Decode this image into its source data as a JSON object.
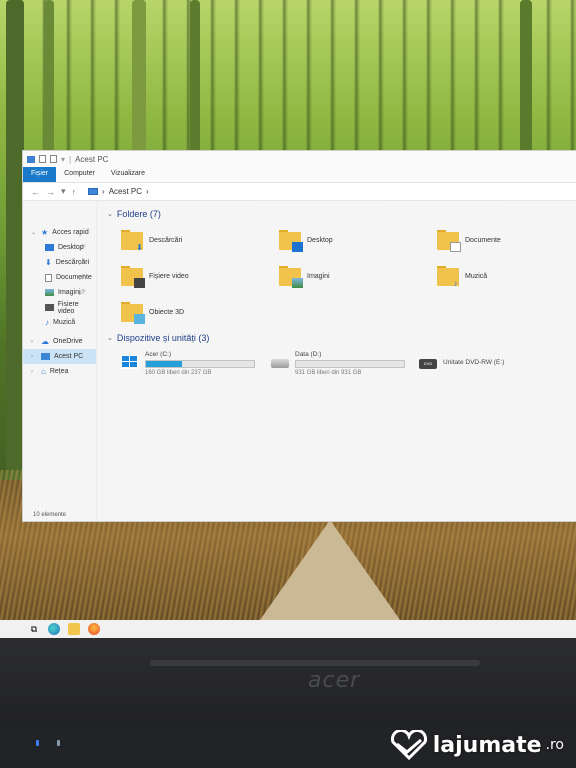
{
  "window": {
    "title": "Acest PC",
    "ribbon_tabs": [
      "Fișier",
      "Computer",
      "Vizualizare"
    ],
    "address": "Acest PC"
  },
  "sidebar": {
    "items": [
      {
        "label": "Acces rapid",
        "icon": "star-icon"
      },
      {
        "label": "Desktop",
        "icon": "desktop-icon"
      },
      {
        "label": "Descărcări",
        "icon": "download-icon"
      },
      {
        "label": "Documente",
        "icon": "document-icon"
      },
      {
        "label": "Imagini",
        "icon": "image-icon"
      },
      {
        "label": "Fisiere video",
        "icon": "video-icon"
      },
      {
        "label": "Muzică",
        "icon": "music-icon"
      },
      {
        "label": "OneDrive",
        "icon": "cloud-icon"
      },
      {
        "label": "Acest PC",
        "icon": "pc-icon"
      },
      {
        "label": "Rețea",
        "icon": "network-icon"
      }
    ],
    "status": "10 elemente"
  },
  "main": {
    "folders_title": "Foldere (7)",
    "folders": [
      {
        "label": "Descărcări",
        "icon": "download-folder-icon"
      },
      {
        "label": "Desktop",
        "icon": "desktop-folder-icon"
      },
      {
        "label": "Documente",
        "icon": "documents-folder-icon"
      },
      {
        "label": "Fișiere video",
        "icon": "video-folder-icon"
      },
      {
        "label": "Imagini",
        "icon": "pictures-folder-icon"
      },
      {
        "label": "Muzică",
        "icon": "music-folder-icon"
      },
      {
        "label": "Obiecte 3D",
        "icon": "3d-objects-folder-icon"
      }
    ],
    "drives_title": "Dispozitive și unități (3)",
    "drives": [
      {
        "label": "Acer (C:)",
        "sub": "160 GB liberi din 237 GB",
        "used_fraction": 0.33,
        "icon": "windows-drive-icon"
      },
      {
        "label": "Data (D:)",
        "sub": "931 GB liberi din 931 GB",
        "used_fraction": 0.0,
        "icon": "hdd-icon"
      },
      {
        "label": "Unitate DVD-RW (E:)",
        "sub": "",
        "icon": "dvd-drive-icon"
      }
    ]
  },
  "laptop": {
    "brand": "acer"
  },
  "watermark": {
    "name": "lajumate",
    "suffix": ".ro"
  },
  "colors": {
    "accent": "#1979ca",
    "bar": "#26a0da",
    "folder": "#f1c34b"
  }
}
